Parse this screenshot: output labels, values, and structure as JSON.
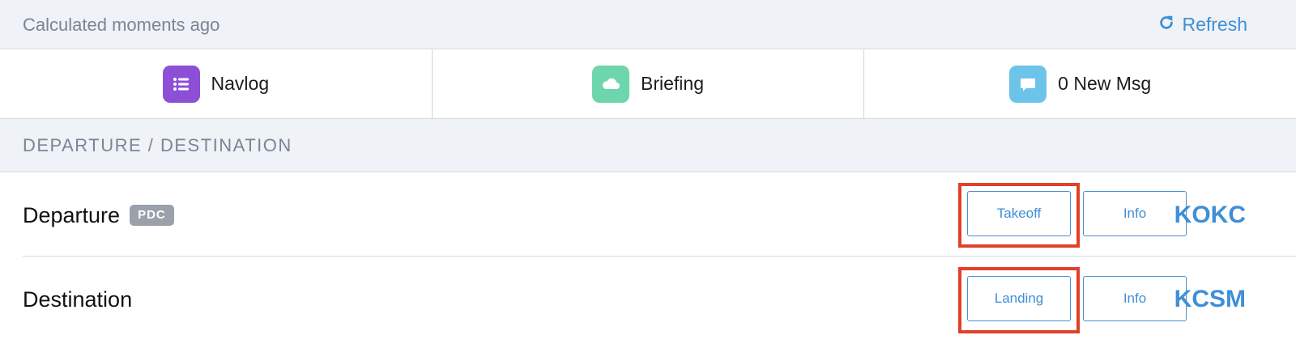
{
  "status": {
    "text": "Calculated moments ago",
    "refresh_label": "Refresh"
  },
  "tabs": [
    {
      "label": "Navlog",
      "icon": "list-icon",
      "color": "#8d4fd6"
    },
    {
      "label": "Briefing",
      "icon": "cloud-icon",
      "color": "#6dd6ac"
    },
    {
      "label": "0 New Msg",
      "icon": "chat-bubble-icon",
      "color": "#6cc4ea"
    }
  ],
  "section": {
    "title": "DEPARTURE / DESTINATION"
  },
  "departure": {
    "label": "Departure",
    "badge": "PDC",
    "action_label": "Takeoff",
    "info_label": "Info",
    "code": "KOKC"
  },
  "destination": {
    "label": "Destination",
    "action_label": "Landing",
    "info_label": "Info",
    "code": "KCSM"
  },
  "colors": {
    "accent": "#3f8fd6",
    "highlight": "#e0412a",
    "header_bg": "#eff2f6"
  }
}
